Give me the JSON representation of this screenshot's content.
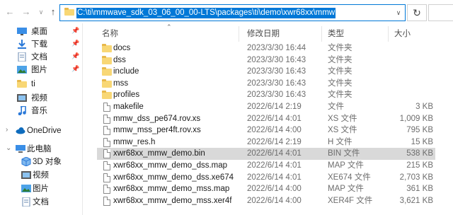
{
  "address_bar": {
    "path": "C:\\ti\\mmwave_sdk_03_06_00_00-LTS\\packages\\ti\\demo\\xwr68xx\\mmw"
  },
  "nav": {
    "back_icon": "arrow-left-icon",
    "forward_icon": "arrow-right-icon",
    "recent_icon": "chevron-down-icon",
    "up_icon": "arrow-up-icon",
    "refresh_icon": "refresh-icon"
  },
  "sidebar": {
    "items": [
      {
        "label": "桌面",
        "icon": "desktop-icon",
        "pinned": true
      },
      {
        "label": "下载",
        "icon": "download-icon",
        "pinned": true
      },
      {
        "label": "文档",
        "icon": "documents-icon",
        "pinned": true
      },
      {
        "label": "图片",
        "icon": "pictures-icon",
        "pinned": true
      },
      {
        "label": "ti",
        "icon": "folder-icon",
        "pinned": false
      },
      {
        "label": "视频",
        "icon": "videos-icon",
        "pinned": false
      },
      {
        "label": "音乐",
        "icon": "music-icon",
        "pinned": false
      },
      {
        "label": "OneDrive",
        "icon": "cloud-icon",
        "pinned": false
      },
      {
        "label": "此电脑",
        "icon": "computer-icon",
        "pinned": false
      },
      {
        "label": "3D 对象",
        "icon": "3d-objects-icon",
        "pinned": false
      },
      {
        "label": "视频",
        "icon": "videos-icon",
        "pinned": false
      },
      {
        "label": "图片",
        "icon": "pictures-icon",
        "pinned": false
      },
      {
        "label": "文档",
        "icon": "documents-icon",
        "pinned": false
      }
    ]
  },
  "columns": {
    "name": "名称",
    "date": "修改日期",
    "type": "类型",
    "size": "大小"
  },
  "files": [
    {
      "name": "docs",
      "date": "2023/3/30 16:44",
      "type": "文件夹",
      "size": "",
      "kind": "folder"
    },
    {
      "name": "dss",
      "date": "2023/3/30 16:43",
      "type": "文件夹",
      "size": "",
      "kind": "folder"
    },
    {
      "name": "include",
      "date": "2023/3/30 16:43",
      "type": "文件夹",
      "size": "",
      "kind": "folder"
    },
    {
      "name": "mss",
      "date": "2023/3/30 16:43",
      "type": "文件夹",
      "size": "",
      "kind": "folder"
    },
    {
      "name": "profiles",
      "date": "2023/3/30 16:43",
      "type": "文件夹",
      "size": "",
      "kind": "folder"
    },
    {
      "name": "makefile",
      "date": "2022/6/14 2:19",
      "type": "文件",
      "size": "3 KB",
      "kind": "file"
    },
    {
      "name": "mmw_dss_pe674.rov.xs",
      "date": "2022/6/14 4:01",
      "type": "XS 文件",
      "size": "1,009 KB",
      "kind": "file"
    },
    {
      "name": "mmw_mss_per4ft.rov.xs",
      "date": "2022/6/14 4:00",
      "type": "XS 文件",
      "size": "795 KB",
      "kind": "file"
    },
    {
      "name": "mmw_res.h",
      "date": "2022/6/14 2:19",
      "type": "H 文件",
      "size": "15 KB",
      "kind": "file"
    },
    {
      "name": "xwr68xx_mmw_demo.bin",
      "date": "2022/6/14 4:01",
      "type": "BIN 文件",
      "size": "538 KB",
      "kind": "file",
      "selected": true
    },
    {
      "name": "xwr68xx_mmw_demo_dss.map",
      "date": "2022/6/14 4:01",
      "type": "MAP 文件",
      "size": "215 KB",
      "kind": "file"
    },
    {
      "name": "xwr68xx_mmw_demo_dss.xe674",
      "date": "2022/6/14 4:01",
      "type": "XE674 文件",
      "size": "2,703 KB",
      "kind": "file"
    },
    {
      "name": "xwr68xx_mmw_demo_mss.map",
      "date": "2022/6/14 4:00",
      "type": "MAP 文件",
      "size": "361 KB",
      "kind": "file"
    },
    {
      "name": "xwr68xx_mmw_demo_mss.xer4f",
      "date": "2022/6/14 4:00",
      "type": "XER4F 文件",
      "size": "3,621 KB",
      "kind": "file"
    }
  ],
  "colors": {
    "accent": "#0078d7",
    "folder": "#f8d775",
    "selected_row": "#d9d9d9",
    "muted_text": "#6d6d6d"
  }
}
